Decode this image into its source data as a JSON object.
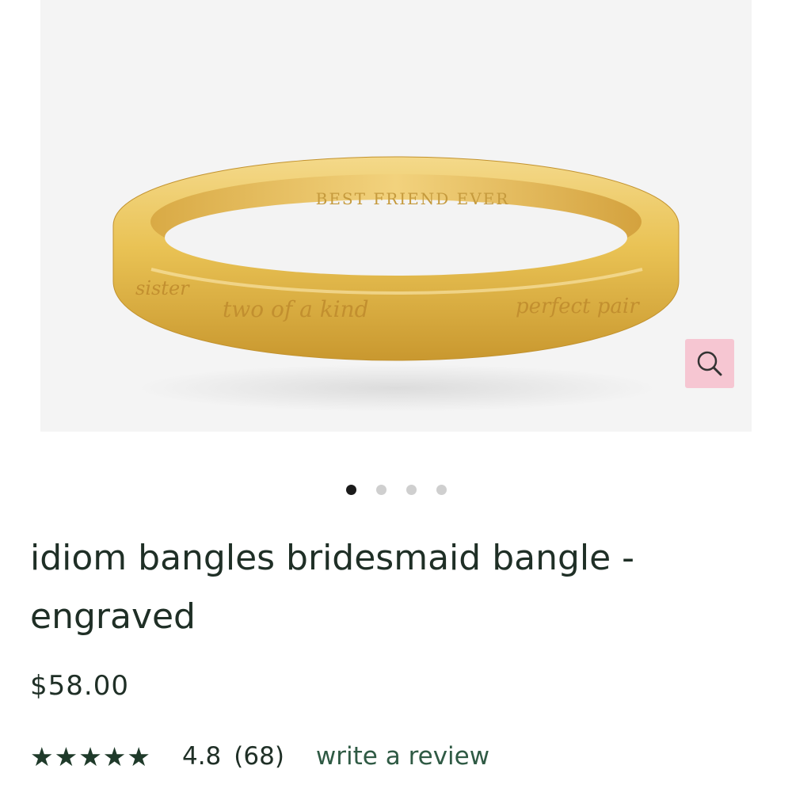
{
  "product": {
    "image": {
      "inner_engraving": "BEST FRIEND EVER",
      "outer_engravings": [
        "sister",
        "two of a kind",
        "perfect pair"
      ]
    },
    "carousel": {
      "total": 4,
      "active_index": 0
    },
    "title": "idiom bangles bridesmaid bangle - engraved",
    "price": "$58.00",
    "rating": {
      "stars": 5,
      "value": "4.8",
      "count": "(68)",
      "write_review_label": "write a review"
    }
  },
  "colors": {
    "accent_pink": "#f6c6d2",
    "text_dark_green": "#1f2f26",
    "link_green": "#2f5a44",
    "gold": "#e8c25a"
  },
  "icons": {
    "zoom": "magnifier-icon",
    "star": "star-icon"
  }
}
